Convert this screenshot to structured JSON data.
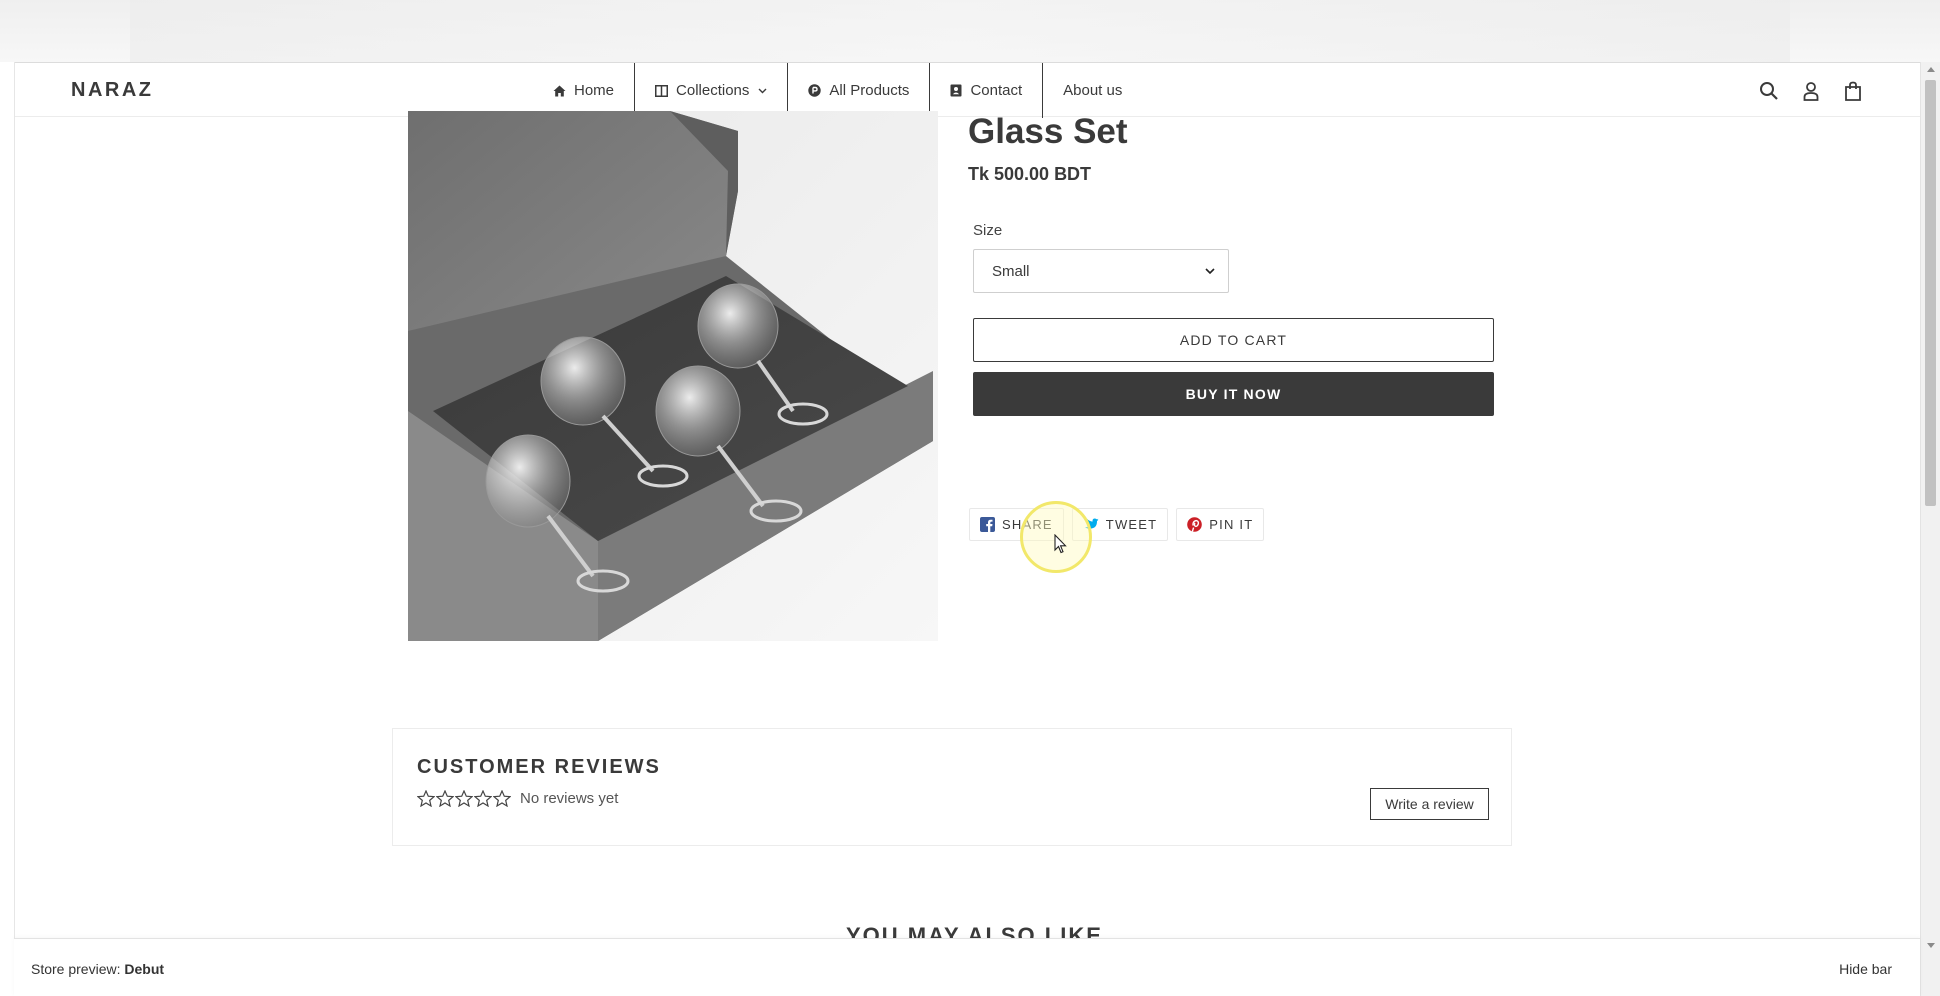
{
  "header": {
    "logo": "NARAZ",
    "nav": [
      {
        "label": "Home",
        "icon": "home-icon"
      },
      {
        "label": "Collections",
        "icon": "columns-icon",
        "has_dropdown": true
      },
      {
        "label": "All Products",
        "icon": "product-circle-icon"
      },
      {
        "label": "Contact",
        "icon": "contact-card-icon"
      },
      {
        "label": "About us"
      }
    ],
    "icons": [
      "search-icon",
      "account-icon",
      "cart-icon"
    ]
  },
  "product": {
    "title": "Glass Set",
    "price": "Tk 500.00 BDT",
    "size_label": "Size",
    "size_value": "Small",
    "add_to_cart": "ADD TO CART",
    "buy_now": "BUY IT NOW",
    "share": {
      "facebook": "SHARE",
      "twitter": "TWEET",
      "pinterest": "PIN IT"
    }
  },
  "reviews": {
    "title": "CUSTOMER REVIEWS",
    "empty_text": "No reviews yet",
    "rating": 0,
    "write_review": "Write a review"
  },
  "related": {
    "title": "YOU MAY ALSO LIKE"
  },
  "preview_bar": {
    "label_prefix": "Store preview:",
    "theme": "Debut",
    "hide": "Hide bar"
  },
  "colors": {
    "text": "#3a3a3a",
    "buy_button": "#3a3a3a",
    "facebook": "#3b5998",
    "twitter": "#00aced",
    "pinterest": "#cb2027",
    "cursor_highlight": "#f2e86a"
  }
}
